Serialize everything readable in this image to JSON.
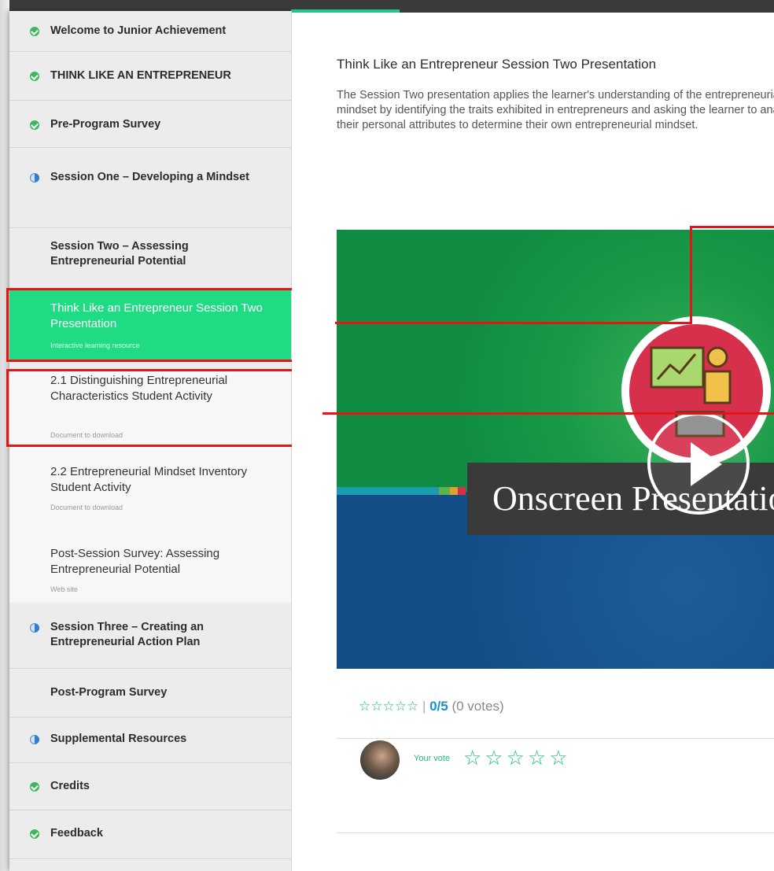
{
  "sidebar": {
    "items": [
      {
        "label": "Welcome to Junior Achievement",
        "status": "complete"
      },
      {
        "label": "THINK LIKE AN ENTREPRENEUR",
        "status": "complete"
      },
      {
        "label": "Pre-Program Survey",
        "status": "complete"
      },
      {
        "label": "Session One – Developing a Mindset",
        "status": "in-progress"
      },
      {
        "label": "Session Two – Assessing Entrepreneurial Potential",
        "status": "none"
      },
      {
        "label": "Session Three – Creating an Entrepreneurial Action Plan",
        "status": "in-progress"
      },
      {
        "label": "Post-Program Survey",
        "status": "none"
      },
      {
        "label": "Supplemental Resources",
        "status": "in-progress"
      },
      {
        "label": "Credits",
        "status": "complete"
      },
      {
        "label": "Feedback",
        "status": "complete"
      }
    ],
    "subitems": [
      {
        "label": "Think Like an Entrepreneur Session Two Presentation",
        "meta": "Interactive learning resource",
        "active": true
      },
      {
        "label": "2.1 Distinguishing Entrepreneurial Characteristics Student Activity",
        "meta": "Document to download",
        "active": false
      },
      {
        "label": "2.2 Entrepreneurial Mindset Inventory Student Activity",
        "meta": "Document to download",
        "active": false
      },
      {
        "label": "Post-Session Survey: Assessing Entrepreneurial Potential",
        "meta": "Web site",
        "active": false
      }
    ]
  },
  "main": {
    "title": "Think Like an Entrepreneur Session Two Presentation",
    "description": "The Session Two presentation applies the learner's understanding of the entrepreneurial mindset by identifying the traits exhibited in entrepreneurs and asking the learner to analyze their personal attributes to determine their own entrepreneurial mindset.",
    "video_caption": "Onscreen Presentation",
    "rating": {
      "stars": "☆☆☆☆☆",
      "separator": "|",
      "score": "0/5",
      "votes": "(0 votes)",
      "value": 0
    },
    "your_vote": {
      "label": "Your vote",
      "stars": "☆☆☆☆☆"
    }
  },
  "colors": {
    "active_green": "#1fdc84",
    "check_green": "#3db85f",
    "highlight_red": "#e51515",
    "star_green": "#1fbf6f"
  }
}
